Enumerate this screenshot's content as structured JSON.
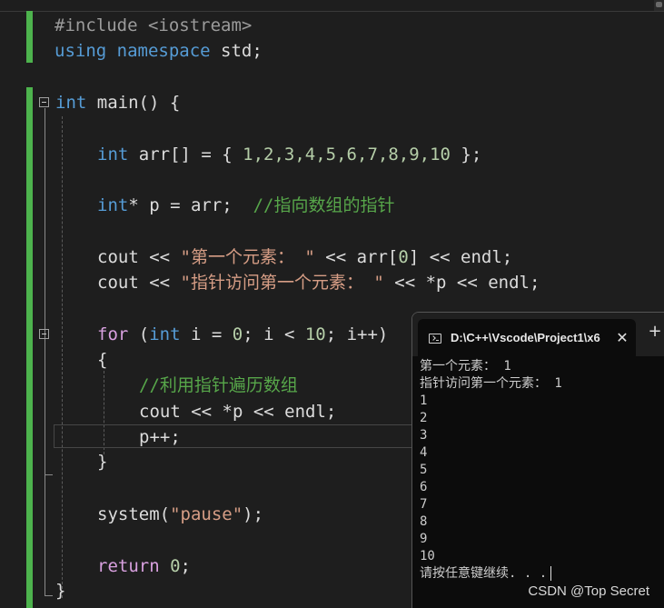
{
  "colors": {
    "keyword": "#569cd6",
    "control_keyword": "#d8a0df",
    "string": "#d69d85",
    "number": "#b5cea8",
    "comment": "#57a64a",
    "preprocessor": "#9b9b9b",
    "text": "#dcdcdc",
    "change_bar": "#4db34d",
    "background": "#1e1e1e"
  },
  "code": {
    "line1": {
      "directive": "#include",
      "header": "<iostream>"
    },
    "line2": {
      "kw_using": "using",
      "kw_namespace": "namespace",
      "rest": " std;"
    },
    "line3": {
      "kw_int": "int",
      "rest": " main() {"
    },
    "line4": {
      "kw_int": "int",
      "decl": " arr[] = { ",
      "values": "1,2,3,4,5,6,7,8,9,10",
      "close": " };"
    },
    "line5": {
      "kw_int": "int",
      "decl": "* p = arr;  ",
      "comment": "//指向数组的指针"
    },
    "line6": {
      "pre": "cout << ",
      "str": "\"第一个元素： \"",
      "post": " << arr[",
      "idx": "0",
      "end": "] << endl;"
    },
    "line7": {
      "pre": "cout << ",
      "str": "\"指针访问第一个元素： \"",
      "end": " << *p << endl;"
    },
    "line8": {
      "kw_for": "for",
      "open": " (",
      "kw_int": "int",
      "mid1": " i = ",
      "zero": "0",
      "mid2": "; i < ",
      "ten": "10",
      "end": "; i++)"
    },
    "line9": {
      "text": "{"
    },
    "line10": {
      "comment": "//利用指针遍历数组"
    },
    "line11": {
      "text": "cout << *p << endl;"
    },
    "line12": {
      "text": "p++;"
    },
    "line13": {
      "text": "}"
    },
    "line14": {
      "pre": "system(",
      "str": "\"pause\"",
      "end": ");"
    },
    "line15": {
      "kw_return": "return",
      "sp": " ",
      "zero": "0",
      "end": ";"
    },
    "line16": {
      "text": "}"
    }
  },
  "terminal": {
    "tab_icon": "terminal-icon",
    "title": "D:\\C++\\Vscode\\Project1\\x6",
    "close_glyph": "✕",
    "new_tab_glyph": "+",
    "lines": [
      "第一个元素： 1",
      "指针访问第一个元素： 1",
      "1",
      "2",
      "3",
      "4",
      "5",
      "6",
      "7",
      "8",
      "9",
      "10",
      "请按任意键继续. . ."
    ]
  },
  "watermark": "CSDN @Top Secret"
}
